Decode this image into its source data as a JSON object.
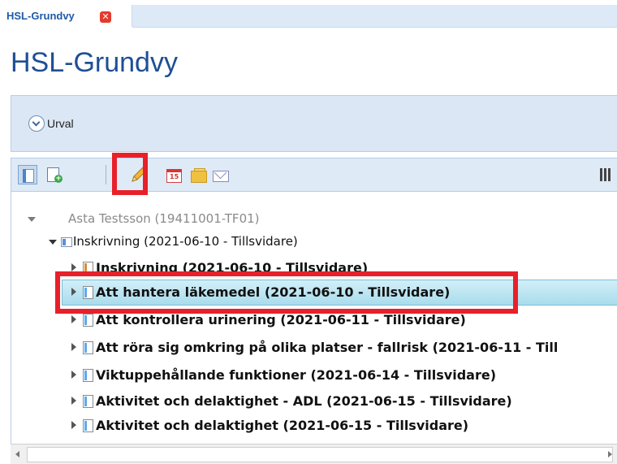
{
  "tab": {
    "label": "HSL-Grundvy",
    "close_symbol": "✕"
  },
  "page": {
    "title": "HSL-Grundvy"
  },
  "urval": {
    "label": "Urval"
  },
  "toolbar": {
    "calendar_number": "15"
  },
  "tree": {
    "root": "Asta Testsson (19411001-TF01)",
    "enrollment": "Inskrivning (2021-06-10 - Tillsvidare)",
    "children": [
      "Inskrivning (2021-06-10 - Tillsvidare)",
      "Att hantera läkemedel (2021-06-10 - Tillsvidare)",
      "Att kontrollera urinering (2021-06-11 - Tillsvidare)",
      "Att röra sig omkring på olika platser - fallrisk (2021-06-11 - Till",
      "Viktuppehållande funktioner (2021-06-14 - Tillsvidare)",
      "Aktivitet och delaktighet - ADL (2021-06-15 - Tillsvidare)",
      "Aktivitet och delaktighet (2021-06-15 - Tillsvidare)"
    ]
  },
  "colors": {
    "title_blue": "#1e4f95",
    "annotation_red": "#e8202a",
    "selection": "#a9dcec"
  }
}
